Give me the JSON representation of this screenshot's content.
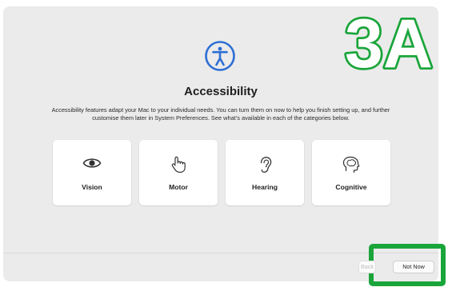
{
  "overlay": {
    "badge_text": "3A"
  },
  "colors": {
    "accent": "#2d6fd4",
    "badge_green": "#1aa53a"
  },
  "page": {
    "title": "Accessibility",
    "description": "Accessibility features adapt your Mac to your individual needs. You can turn them on now to help you finish setting up, and further customise them later in System Preferences. See what’s available in each of the categories below."
  },
  "categories": [
    {
      "label": "Vision",
      "icon": "eye-icon"
    },
    {
      "label": "Motor",
      "icon": "pointing-hand-icon"
    },
    {
      "label": "Hearing",
      "icon": "ear-icon"
    },
    {
      "label": "Cognitive",
      "icon": "brain-icon"
    }
  ],
  "footer": {
    "back_label": "Back",
    "not_now_label": "Not Now"
  }
}
